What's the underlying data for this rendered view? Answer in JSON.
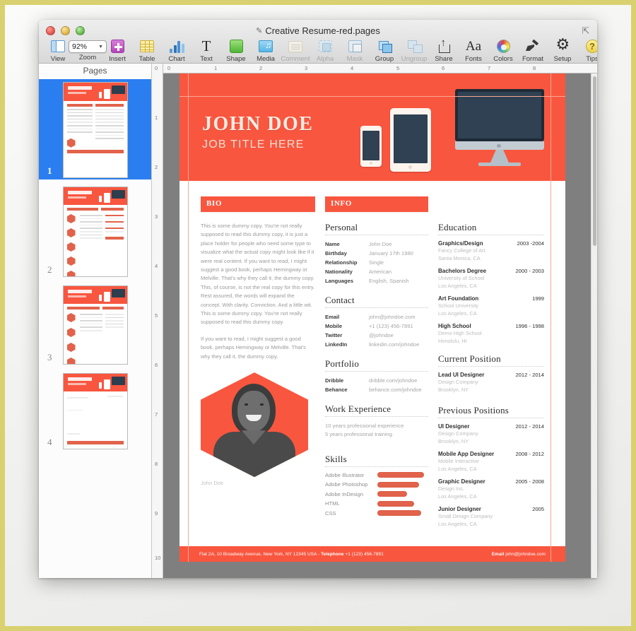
{
  "window": {
    "title": "Creative Resume-red.pages",
    "lock_icon": "edit-lock-icon",
    "fullscreen_icon": "fullscreen-icon"
  },
  "toolbar": {
    "zoom_value": "92%",
    "items": [
      {
        "label": "View",
        "icon": "view-icon",
        "enabled": true
      },
      {
        "label": "Zoom",
        "icon": "zoom-icon",
        "enabled": true
      },
      {
        "label": "Insert",
        "icon": "insert-icon",
        "enabled": true
      },
      {
        "label": "Table",
        "icon": "table-icon",
        "enabled": true
      },
      {
        "label": "Chart",
        "icon": "chart-icon",
        "enabled": true
      },
      {
        "label": "Text",
        "icon": "text-icon",
        "enabled": true
      },
      {
        "label": "Shape",
        "icon": "shape-icon",
        "enabled": true
      },
      {
        "label": "Media",
        "icon": "media-icon",
        "enabled": true
      },
      {
        "label": "Comment",
        "icon": "comment-icon",
        "enabled": false
      },
      {
        "label": "Alpha",
        "icon": "alpha-icon",
        "enabled": false
      },
      {
        "label": "Mask",
        "icon": "mask-icon",
        "enabled": false
      },
      {
        "label": "Group",
        "icon": "group-icon",
        "enabled": true
      },
      {
        "label": "Ungroup",
        "icon": "ungroup-icon",
        "enabled": false
      },
      {
        "label": "Share",
        "icon": "share-icon",
        "enabled": true
      },
      {
        "label": "Fonts",
        "icon": "fonts-icon",
        "enabled": true
      },
      {
        "label": "Colors",
        "icon": "colors-icon",
        "enabled": true
      },
      {
        "label": "Format",
        "icon": "format-icon",
        "enabled": true
      },
      {
        "label": "Setup",
        "icon": "setup-icon",
        "enabled": true
      },
      {
        "label": "Tips",
        "icon": "tips-icon",
        "enabled": true
      }
    ]
  },
  "sidebar": {
    "title": "Pages",
    "selected_page": 1,
    "thumbnails": [
      {
        "number": "1"
      },
      {
        "number": "2"
      },
      {
        "number": "3"
      },
      {
        "number": "4"
      }
    ]
  },
  "rulers": {
    "horizontal_ticks": [
      "0",
      "1",
      "2",
      "3",
      "4",
      "5",
      "6",
      "7",
      "8"
    ],
    "vertical_ticks": [
      "0",
      "1",
      "2",
      "3",
      "4",
      "5",
      "6",
      "7",
      "8",
      "9",
      "10"
    ]
  },
  "colors": {
    "accent_red": "#f9563f",
    "bar_red": "#e2624b",
    "canvas_gray": "#7f7f7f",
    "guide_orange": "#f7a893"
  },
  "document": {
    "header": {
      "name": "JOHN DOE",
      "job_title": "JOB TITLE HERE",
      "devices": [
        "phone-illustration",
        "tablet-illustration",
        "monitor-illustration"
      ]
    },
    "bio": {
      "banner": "BIO",
      "paragraphs": [
        "This is some dummy copy. You're not really supposed to read this dummy copy, it is just a place holder for people who need some type to visualize what the actual copy might look like if it were real content. If you want to read, I might suggest a good book, perhaps Hemingway or Melville. That's why they call it, the dummy copy. This, of course, is not the real copy for this entry. Rest assured, the words will expand the concept. With clarity. Conviction. And a little wit. This is some dummy copy. You're not really supposed to read this dummy copy.",
        "If you want to read, I might suggest a good book, perhaps Hemingway or Melville. That's why they call it, the dummy copy."
      ],
      "photo_caption": "John Doe"
    },
    "info": {
      "banner": "INFO",
      "personal": {
        "heading": "Personal",
        "rows": [
          {
            "key": "Name",
            "value": "John Doe"
          },
          {
            "key": "Birthday",
            "value": "January 17th 1980"
          },
          {
            "key": "Relationship",
            "value": "Single"
          },
          {
            "key": "Nationality",
            "value": "American"
          },
          {
            "key": "Languages",
            "value": "English, Spanish"
          }
        ]
      },
      "contact": {
        "heading": "Contact",
        "rows": [
          {
            "key": "Email",
            "value": "john@johndoe.com"
          },
          {
            "key": "Mobile",
            "value": "+1 (123) 456-7891"
          },
          {
            "key": "Twitter",
            "value": "@johndoe"
          },
          {
            "key": "LinkedIn",
            "value": "linkedin.com/johndoe"
          }
        ]
      },
      "portfolio": {
        "heading": "Portfolio",
        "rows": [
          {
            "key": "Dribble",
            "value": "dribble.com/johndoe"
          },
          {
            "key": "Behance",
            "value": "behance.com/johndoe"
          }
        ]
      },
      "work_experience": {
        "heading": "Work Experience",
        "lines": [
          "10 years professional experience",
          "5 years professional training"
        ]
      },
      "skills": {
        "heading": "Skills",
        "items": [
          {
            "name": "Adobe Illustrator",
            "level": 92
          },
          {
            "name": "Adobe Photoshop",
            "level": 82
          },
          {
            "name": "Adobe InDesign",
            "level": 58
          },
          {
            "name": "HTML",
            "level": 72
          },
          {
            "name": "CSS",
            "level": 86
          }
        ]
      }
    },
    "education": {
      "heading": "Education",
      "entries": [
        {
          "title": "Graphics/Design",
          "date": "2003 -2004",
          "org": "Fancy College of Art",
          "location": "Santa Monica, CA"
        },
        {
          "title": "Bachelors Degree",
          "date": "2000 - 2003",
          "org": "University of School",
          "location": "Los Angeles, CA"
        },
        {
          "title": "Art Foundation",
          "date": "1999",
          "org": "School University",
          "location": "Los Angeles, CA"
        },
        {
          "title": "High School",
          "date": "1996 - 1998",
          "org": "Demo High School",
          "location": "Honolulu, HI"
        }
      ]
    },
    "current_position": {
      "heading": "Current Position",
      "entries": [
        {
          "title": "Lead UI Designer",
          "date": "2012 - 2014",
          "org": "Design Company",
          "location": "Brooklyn, NY"
        }
      ]
    },
    "previous_positions": {
      "heading": "Previous Positions",
      "entries": [
        {
          "title": "UI Designer",
          "date": "2012 - 2014",
          "org": "Design Company",
          "location": "Brooklyn, NY"
        },
        {
          "title": "Mobile App Designer",
          "date": "2008 - 2012",
          "org": "Mobile Interactive",
          "location": "Los Angeles, CA"
        },
        {
          "title": "Graphic Designer",
          "date": "2005 - 2008",
          "org": "Design Inc.",
          "location": "Los Angeles, CA"
        },
        {
          "title": "Junior Designer",
          "date": "2005",
          "org": "Small Design Company",
          "location": "Los Angeles, CA"
        }
      ]
    },
    "footer": {
      "address": "Flat 2A, 10 Broadway Avenue, New York, NY 12345 USA - ",
      "telephone_label": "Telephone",
      "telephone": " +1 (123) 456-7891",
      "email_label": "Email",
      "email": " john@johndoe.com"
    }
  }
}
